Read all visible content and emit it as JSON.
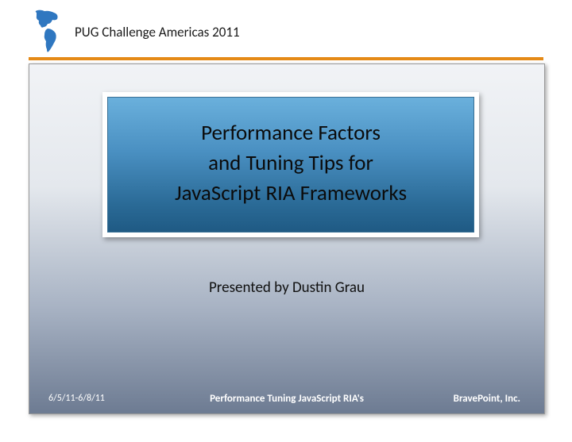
{
  "header": {
    "conference": "PUG Challenge Americas 2011",
    "logo_name": "americas-map-icon"
  },
  "title": {
    "line1": "Performance Factors",
    "line2": "and Tuning Tips for",
    "line3": "JavaScript RIA Frameworks"
  },
  "presenter": "Presented by Dustin Grau",
  "footer": {
    "date": "6/5/11-6/8/11",
    "title": "Performance Tuning JavaScript RIA's",
    "company": "BravePoint, Inc."
  },
  "colors": {
    "accent_orange": "#e58a17",
    "title_box_top": "#6ab0dc",
    "title_box_bottom": "#1f5a84"
  }
}
